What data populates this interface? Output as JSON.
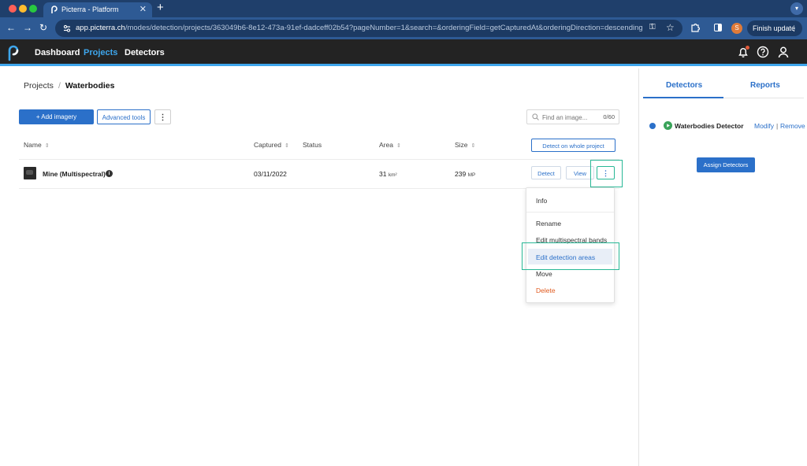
{
  "browser": {
    "tab_title": "Picterra - Platform",
    "tab_close": "✕",
    "new_tab": "+",
    "url_domain": "app.picterra.ch",
    "url_path": "/modes/detection/projects/363049b6-8e12-473a-91ef-dadceff02b54?pageNumber=1&search=&orderingField=getCapturedAt&orderingDirection=descending",
    "profile_initial": "S",
    "finish_update": "Finish update"
  },
  "nav": {
    "dashboard": "Dashboard",
    "projects": "Projects",
    "detectors": "Detectors"
  },
  "breadcrumb": {
    "root": "Projects",
    "separator": "/",
    "current": "Waterbodies"
  },
  "toolbar": {
    "add_imagery": "+ Add imagery",
    "advanced_tools": "Advanced tools",
    "more": "⋮"
  },
  "search": {
    "placeholder": "Find an image...",
    "count": "0/60"
  },
  "table": {
    "headers": {
      "name": "Name",
      "captured": "Captured",
      "status": "Status",
      "area": "Area",
      "size": "Size"
    },
    "sort_glyph": "⇕",
    "detect_all": "Detect on whole project",
    "rows": [
      {
        "name": "Mine (Multispectral)",
        "captured": "03/11/2022",
        "status": "",
        "area_value": "31",
        "area_unit": "km²",
        "size_value": "239",
        "size_unit": "MP",
        "detect_label": "Detect",
        "view_label": "View",
        "more_label": "⋮"
      }
    ]
  },
  "row_menu": {
    "items": [
      "Info",
      "Rename",
      "Edit multispectral bands",
      "Edit detection areas",
      "Move",
      "Delete"
    ],
    "selected": "Edit detection areas"
  },
  "right_panel": {
    "tabs": [
      "Detectors",
      "Reports"
    ],
    "active_tab": "Detectors",
    "detector": {
      "name": "Waterbodies Detector",
      "modify": "Modify",
      "separator": "|",
      "remove": "Remove"
    },
    "assign_button": "Assign Detectors"
  },
  "colors": {
    "tabbar": "#1f3f6b",
    "toolbar": "#2e5a94",
    "appnav": "#232323",
    "accent": "#2b70c9",
    "nav_active": "#3ea6ec",
    "highlight": "#28b896",
    "danger": "#e05a1f"
  },
  "icons": [
    "picterra-favicon",
    "back-arrow-icon",
    "forward-arrow-icon",
    "reload-icon",
    "site-settings-icon",
    "key-icon",
    "star-icon",
    "extensions-icon",
    "side-panel-icon",
    "picterra-logo",
    "bell-icon",
    "help-icon",
    "user-icon",
    "search-icon",
    "info-icon",
    "play-icon"
  ]
}
